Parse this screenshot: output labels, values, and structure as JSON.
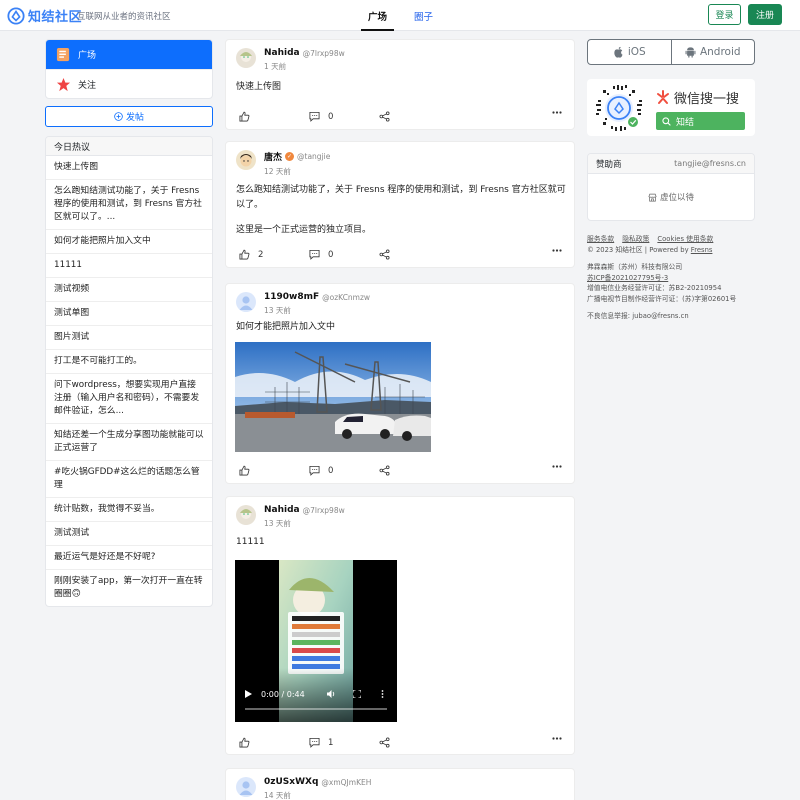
{
  "header": {
    "logo_text": "知结社区",
    "slogan": "互联网从业者的资讯社区",
    "tabs": [
      {
        "label": "广场"
      },
      {
        "label": "圈子"
      }
    ],
    "login_label": "登录",
    "register_label": "注册"
  },
  "sidebar": {
    "menu": [
      {
        "label": "广场"
      },
      {
        "label": "关注"
      }
    ],
    "post_button_label": "发帖",
    "hot_title": "今日热议",
    "hot_items": [
      "快速上传图",
      "怎么跑知结测试功能了，关于 Fresns 程序的使用和测试，到 Fresns 官方社区就可以了。...",
      "如何才能把照片加入文中",
      "11111",
      "测试视频",
      "测试单图",
      "图片测试",
      "打工是不可能打工的。",
      "问下wordpress，想要实现用户直接注册（输入用户名和密码），不需要发邮件验证，怎么...",
      "知结还差一个生成分享图功能就能可以正式运营了",
      "#吃火锅GFDD#这么烂的话题怎么管理",
      "统计贴数，我觉得不妥当。",
      "测试测试",
      "最近运气是好还是不好呢?",
      "刚刚安装了app，第一次打开一直在转圈圈🙃"
    ]
  },
  "posts": [
    {
      "name": "Nahida",
      "handle": "@7lrxp98w",
      "time": "1 天前",
      "text": "快速上传图",
      "likes": "",
      "comments": "0"
    },
    {
      "name": "唐杰",
      "handle": "@tangjie",
      "time": "12 天前",
      "text": "怎么跑知结测试功能了，关于 Fresns 程序的使用和测试，到 Fresns 官方社区就可以了。",
      "text2": "这里是一个正式运营的独立项目。",
      "likes": "2",
      "comments": "0"
    },
    {
      "name": "1190w8mF",
      "handle": "@ozKCnmzw",
      "time": "13 天前",
      "text": "如何才能把照片加入文中",
      "likes": "",
      "comments": "0"
    },
    {
      "name": "Nahida",
      "handle": "@7lrxp98w",
      "time": "13 天前",
      "text": "11111",
      "likes": "",
      "comments": "1",
      "video_time": "0:00 / 0:44"
    },
    {
      "name": "0zUSxWXq",
      "handle": "@xmQJmKEH",
      "time": "14 天前"
    }
  ],
  "right": {
    "ios_label": "iOS",
    "android_label": "Android",
    "wechat_title": "微信搜一搜",
    "wechat_search": "知结",
    "sponsor_title": "赞助商",
    "sponsor_email": "tangjie@fresns.cn",
    "sponsor_placeholder": "虚位以待"
  },
  "footer": {
    "links": [
      "服务条款",
      "隐私政策",
      "Cookies 使用条款"
    ],
    "copyright": "© 2023 知结社区 | Powered by ",
    "powered": "Fresns",
    "company": "弗霖森斯（苏州）科技有限公司",
    "icp": "苏ICP备2021027795号-3",
    "license1": "增值电信业务经营许可证：苏B2-20210954",
    "license2": "广播电视节目制作经营许可证：(苏)字第02601号",
    "report": "不良信息举报: jubao@fresns.cn"
  },
  "colors": {
    "primary": "#0d6efd",
    "success": "#198754",
    "logo": "#3b82f6",
    "wechat": "#4db35f"
  }
}
